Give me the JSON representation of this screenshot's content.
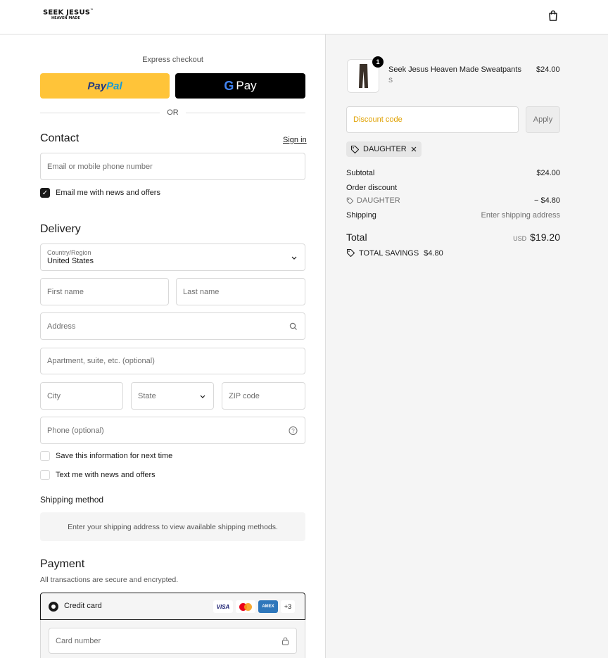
{
  "header": {
    "logo_line1": "SEEK JESUS",
    "logo_tm": "™",
    "logo_line2": "HEAVEN MADE"
  },
  "express": {
    "label": "Express checkout",
    "paypal_part1": "Pay",
    "paypal_part2": "Pal",
    "gpay_g": "G",
    "gpay_text": "Pay",
    "or": "OR"
  },
  "contact": {
    "title": "Contact",
    "sign_in": "Sign in",
    "email_placeholder": "Email or mobile phone number",
    "email_news_label": "Email me with news and offers",
    "email_news_checked": true
  },
  "delivery": {
    "title": "Delivery",
    "country_label": "Country/Region",
    "country_value": "United States",
    "first_name": "First name",
    "last_name": "Last name",
    "address": "Address",
    "apartment": "Apartment, suite, etc. (optional)",
    "city": "City",
    "state": "State",
    "zip": "ZIP code",
    "phone": "Phone (optional)",
    "save_info": "Save this information for next time",
    "text_news": "Text me with news and offers"
  },
  "shipping": {
    "title": "Shipping method",
    "message": "Enter your shipping address to view available shipping methods."
  },
  "payment": {
    "title": "Payment",
    "subtitle": "All transactions are secure and encrypted.",
    "method": "Credit card",
    "card_visa": "VISA",
    "card_amex": "AMEX",
    "card_more": "+3",
    "card_number": "Card number"
  },
  "order": {
    "product_name": "Seek Jesus Heaven Made Sweatpants",
    "product_variant": "S",
    "product_price": "$24.00",
    "quantity": "1",
    "discount_placeholder": "Discount code",
    "apply": "Apply",
    "applied_code": "DAUGHTER",
    "subtotal_label": "Subtotal",
    "subtotal_value": "$24.00",
    "order_discount_label": "Order discount",
    "discount_code_line": "DAUGHTER",
    "discount_value": "− $4.80",
    "shipping_label": "Shipping",
    "shipping_value": "Enter shipping address",
    "total_label": "Total",
    "currency": "USD",
    "total_value": "$19.20",
    "savings_label": "TOTAL SAVINGS",
    "savings_value": "$4.80"
  },
  "colors": {
    "paypal_yellow": "#ffc439",
    "discount_text": "#e0a100"
  }
}
